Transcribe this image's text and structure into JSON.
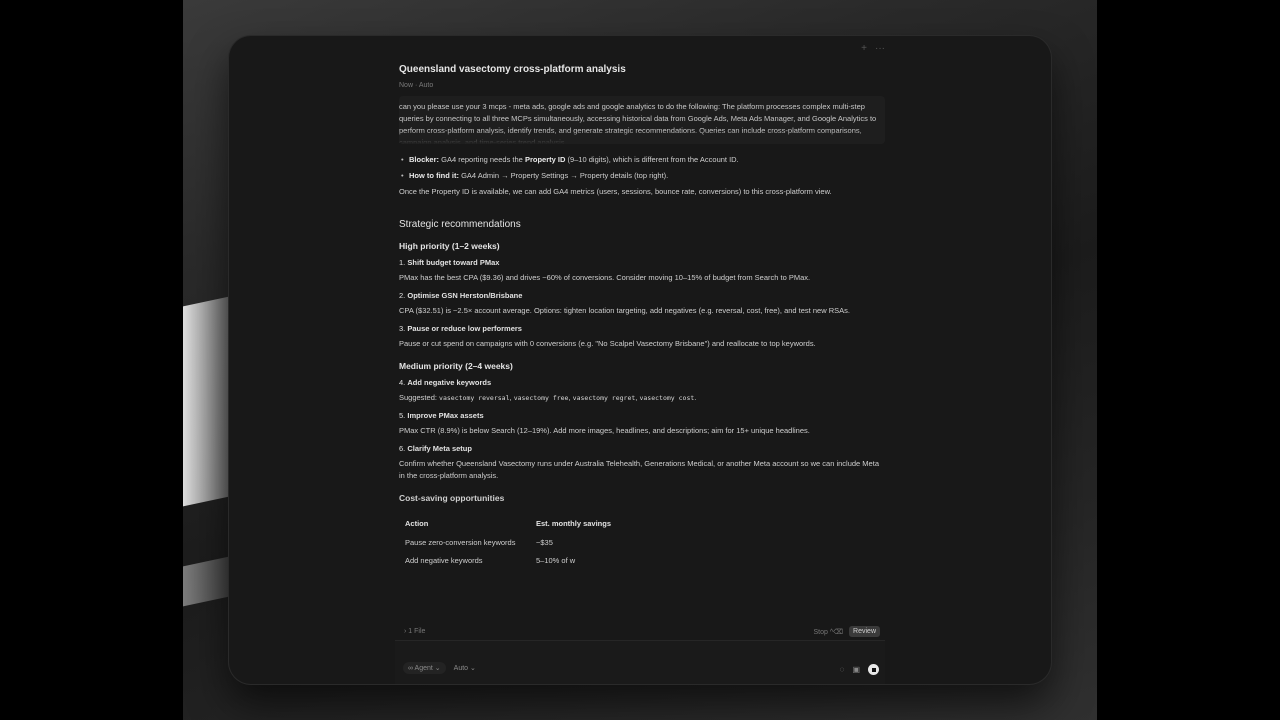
{
  "window": {
    "title": "Queensland vasectomy cross-platform analysis",
    "meta": [
      "Now",
      "Auto"
    ],
    "actions": [
      "+",
      "···"
    ]
  },
  "prompt": {
    "text": "can you please use your 3 mcps - meta ads, google ads and google analytics to do the following: The platform processes complex multi-step queries by connecting to all three MCPs simultaneously, accessing historical data from Google Ads, Meta Ads Manager, and Google Analytics to perform cross-platform analysis, identify trends, and generate strategic recommendations. Queries can include cross-platform comparisons, campaign analysis, and time-series trend analysis"
  },
  "notes": {
    "blocker_label": "Blocker:",
    "blocker_text_1": "GA4 reporting needs the",
    "blocker_bold": "Property ID",
    "blocker_text_2": "(9–10 digits), which is different from the Account ID.",
    "howto_label": "How to find it:",
    "howto_text": "GA4 Admin → Property Settings → Property details (top right).",
    "para": "Once the Property ID is available, we can add GA4 metrics (users, sessions, bounce rate, conversions) to this cross-platform view."
  },
  "recommendations": {
    "heading": "Strategic recommendations",
    "high_heading": "High priority (1–2 weeks)",
    "high_items": [
      {
        "num": "1.",
        "title": "Shift budget toward PMax",
        "body": "PMax has the best CPA ($9.36) and drives ~60% of conversions. Consider moving 10–15% of budget from Search to PMax."
      },
      {
        "num": "2.",
        "title": "Optimise GSN Herston/Brisbane",
        "body": "CPA ($32.51) is ~2.5× account average. Options: tighten location targeting, add negatives (e.g. reversal, cost, free), and test new RSAs."
      },
      {
        "num": "3.",
        "title": "Pause or reduce low performers",
        "body": "Pause or cut spend on campaigns with 0 conversions (e.g. \"No Scalpel Vasectomy Brisbane\") and reallocate to top keywords."
      }
    ],
    "medium_heading": "Medium priority (2–4 weeks)",
    "item4": {
      "num": "4.",
      "title": "Add negative keywords",
      "prefix": "Suggested:",
      "codes": [
        "vasectomy reversal",
        "vasectomy free",
        "vasectomy regret",
        "vasectomy cost"
      ],
      "sep": ",",
      "end": "."
    },
    "item5": {
      "num": "5.",
      "title": "Improve PMax assets",
      "body": "PMax CTR (8.9%) is below Search (12–19%). Add more images, headlines, and descriptions; aim for 15+ unique headlines."
    },
    "item6": {
      "num": "6.",
      "title": "Clarify Meta setup",
      "body": "Confirm whether Queensland Vasectomy runs under Australia Telehealth, Generations Medical, or another Meta account so we can include Meta in the cross-platform analysis."
    },
    "saving_heading": "Cost-saving opportunities"
  },
  "table": {
    "headers": [
      "Action",
      "Est. monthly savings"
    ],
    "rows": [
      [
        "Pause zero-conversion keywords",
        "~$35"
      ],
      [
        "Add negative keywords",
        "5–10% of w"
      ]
    ]
  },
  "footer": {
    "files": "› 1 File",
    "stop": "Stop",
    "stop_shortcut": "^⌫",
    "review": "Review"
  },
  "composer": {
    "agent": "∞ Agent",
    "agent_caret": "⌄",
    "model": "Auto",
    "model_caret": "⌄"
  }
}
